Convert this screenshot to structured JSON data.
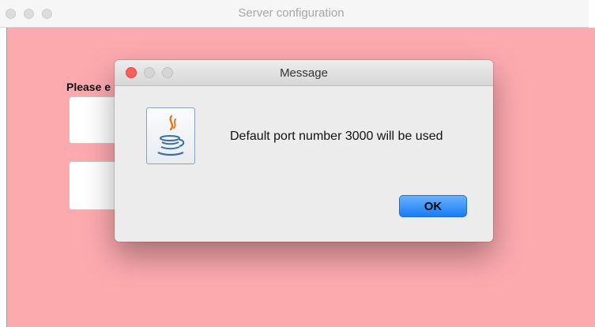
{
  "main_window": {
    "title": "Server configuration",
    "prompt_label": "Please e"
  },
  "dialog": {
    "title": "Message",
    "message": "Default port number 3000 will be used",
    "ok_label": "OK",
    "icon": "java-icon"
  },
  "colors": {
    "window_background": "#fdaaaf",
    "close_button": "#fc5f58",
    "ok_button": "#1a7cf3"
  }
}
